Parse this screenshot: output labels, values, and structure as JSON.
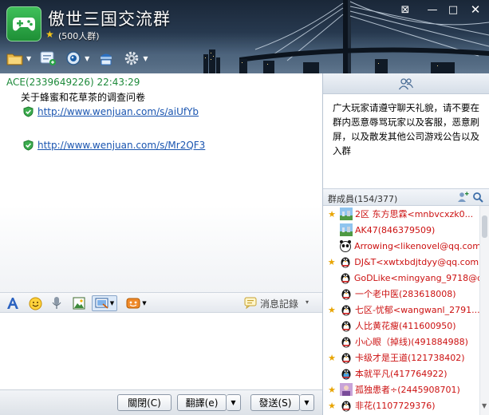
{
  "window": {
    "title": "傲世三国交流群",
    "member_limit": "(500人群)",
    "rank_star": "★",
    "controls": {
      "skin": "⊠",
      "minimize": "—",
      "maximize": "□",
      "close": "✕"
    }
  },
  "toolbar": {
    "items": [
      {
        "name": "folder-icon",
        "dropdown": true
      },
      {
        "name": "group-app-icon",
        "dropdown": false
      },
      {
        "name": "video-icon",
        "dropdown": true
      },
      {
        "name": "sharing-icon",
        "dropdown": false
      },
      {
        "name": "gear-icon",
        "dropdown": true
      }
    ]
  },
  "chat": {
    "sender": "ACE(2339649226)  22:43:29",
    "subject": "关于蜂蜜和花草茶的调查问卷",
    "links": [
      "http://www.wenjuan.com/s/aiUfYb",
      "http://www.wenjuan.com/s/Mr2QF3"
    ]
  },
  "input_toolbar": {
    "history_label": "消息記錄",
    "history_dropdown": "▾"
  },
  "buttons": {
    "close": "關閉(C)",
    "translate": "翻譯(e)",
    "send": "發送(S)",
    "dropdown": "▼"
  },
  "announcement": {
    "text": "广大玩家请遵守聊天礼貌，请不要在群内恶意辱骂玩家以及客服，恶意刷屏，以及散发其他公司游戏公告以及入群"
  },
  "members": {
    "header": "群成員(154/377)",
    "list": [
      {
        "star": "★",
        "avatar": "landscape",
        "name": "2区  东方思霖<mnbvcxzk0..."
      },
      {
        "star": "",
        "avatar": "landscape2",
        "name": "AK47(846379509)"
      },
      {
        "star": "",
        "avatar": "panda",
        "name": "Arrowing<likenovel@qq.com>"
      },
      {
        "star": "★",
        "avatar": "penguin",
        "name": "DJ&T<xwtxbdjtdyy@qq.com>"
      },
      {
        "star": "",
        "avatar": "penguin",
        "name": "GoDLike<mingyang_9718@q..."
      },
      {
        "star": "",
        "avatar": "penguin",
        "name": "一个老中医(283618008)"
      },
      {
        "star": "★",
        "avatar": "penguin",
        "name": "七区-忧郁<wangwanl_2791..."
      },
      {
        "star": "",
        "avatar": "penguin",
        "name": "人比黄花瘦(411600950)"
      },
      {
        "star": "",
        "avatar": "penguin",
        "name": "小心眼（掉线)(491884988)"
      },
      {
        "star": "★",
        "avatar": "penguin",
        "name": "卡级才是王道(121738402)"
      },
      {
        "star": "",
        "avatar": "penguin-blue",
        "name": "本就平凡(417764922)"
      },
      {
        "star": "★",
        "avatar": "photo",
        "name": "孤独患者÷(2445908701)"
      },
      {
        "star": "★",
        "avatar": "penguin",
        "name": "非花(1107729376)"
      }
    ]
  },
  "colors": {
    "sender": "#1d8a3a",
    "link": "#1a55b0",
    "member_name": "#cc1111",
    "star": "#e8a400",
    "logo_green": "#2aa646"
  }
}
